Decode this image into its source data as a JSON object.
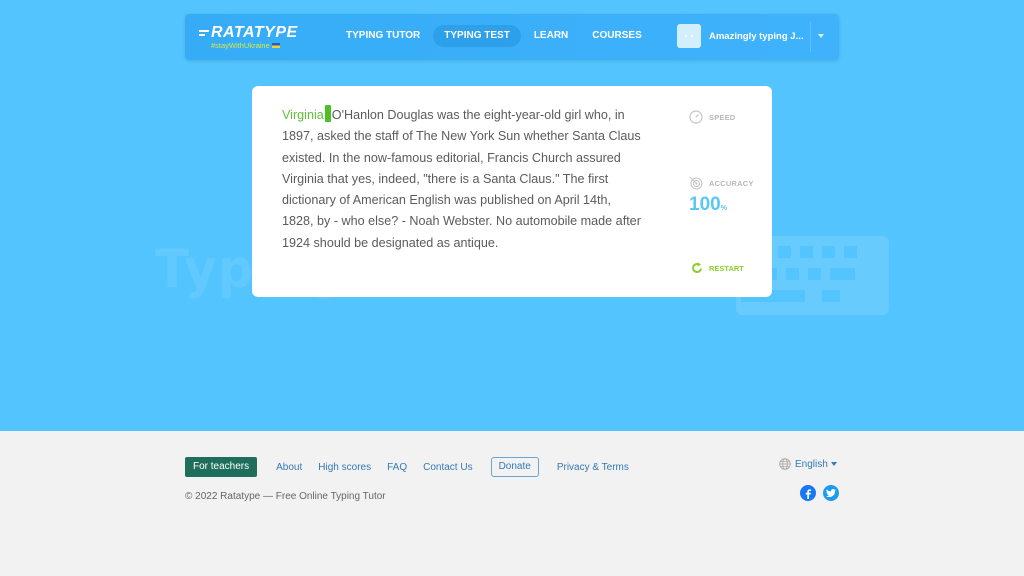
{
  "header": {
    "logo": "RATATYPE",
    "logo_tag": "#stayWithUkraine",
    "nav": [
      {
        "label": "TYPING TUTOR",
        "active": false
      },
      {
        "label": "TYPING TEST",
        "active": true
      },
      {
        "label": "LEARN",
        "active": false
      },
      {
        "label": "COURSES",
        "active": false
      }
    ],
    "user_name": "Amazingly typing J...",
    "user_caret_icon": "chevron-down-icon"
  },
  "typing": {
    "typed_text": "Virginia",
    "remaining_text": "O'Hanlon Douglas was the eight-year-old girl who, in 1897, asked the staff of The New York Sun whether Santa Claus existed. In the now-famous editorial, Francis Church assured Virginia that yes, indeed, \"there is a Santa Claus.\" The first dictionary of American English was published on April 14th, 1828, by - who else? - Noah Webster. No automobile made after 1924 should be designated as antique.",
    "typed_color": "#62be3b",
    "cursor_color": "#4fbf29"
  },
  "stats": {
    "speed_label": "SPEED",
    "accuracy_label": "ACCURACY",
    "accuracy_value": "100",
    "accuracy_unit": "%",
    "accuracy_color": "#5ac8f5",
    "restart_label": "RESTART",
    "restart_color": "#8bd12d"
  },
  "watermark": "TypingDoneWell.com",
  "footer": {
    "teachers_label": "For teachers",
    "links": [
      "About",
      "High scores",
      "FAQ",
      "Contact Us"
    ],
    "donate_label": "Donate",
    "privacy_label": "Privacy & Terms",
    "copyright": "© 2022 Ratatype — Free Online Typing Tutor",
    "language": "English",
    "social": [
      "facebook-icon",
      "twitter-icon"
    ]
  },
  "colors": {
    "hero_bg": "#53c4fe",
    "footer_bg": "#f2f2f2",
    "link": "#337ab7",
    "teachers_bg": "#1f6e5c"
  }
}
